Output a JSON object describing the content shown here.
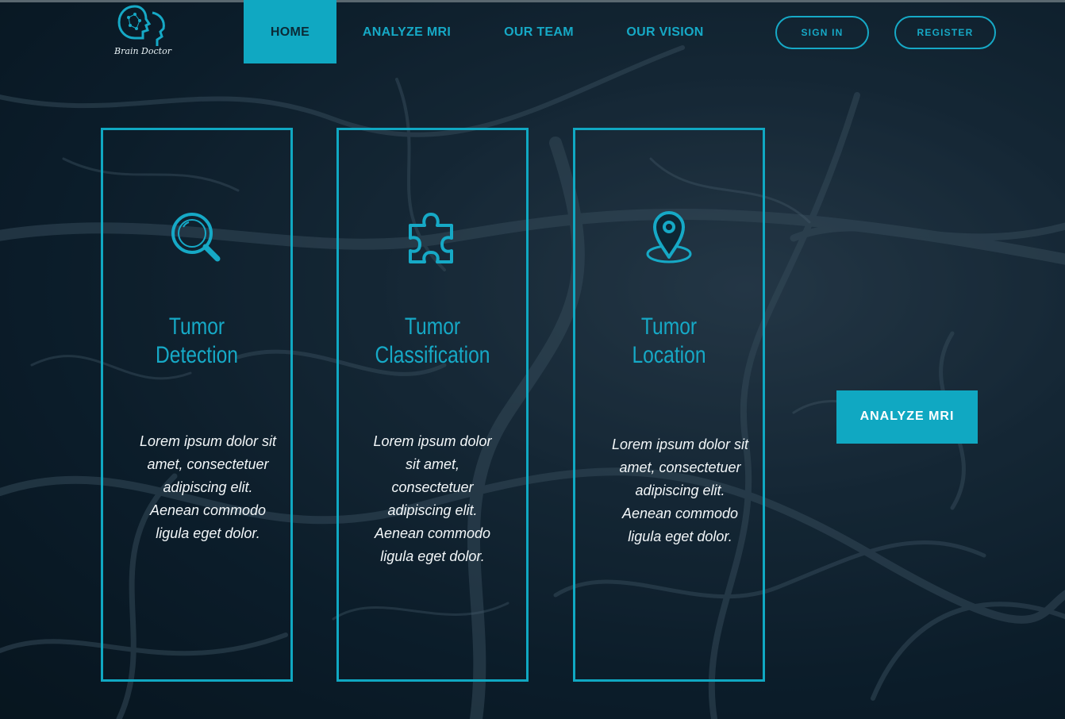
{
  "brand": {
    "name": "Brain Doctor",
    "accent": "#10a8c2"
  },
  "nav": {
    "items": [
      {
        "label": "HOME",
        "active": true
      },
      {
        "label": "ANALYZE MRI",
        "active": false
      },
      {
        "label": "OUR TEAM",
        "active": false
      },
      {
        "label": "OUR VISION",
        "active": false
      }
    ]
  },
  "auth": {
    "sign_in": "SIGN IN",
    "register": "REGISTER"
  },
  "cards": [
    {
      "icon": "magnifier-icon",
      "title_line1": "Tumor",
      "title_line2": "Detection",
      "text": "Lorem ipsum dolor sit amet, consectetuer adipiscing elit. Aenean commodo ligula eget dolor."
    },
    {
      "icon": "puzzle-icon",
      "title_line1": "Tumor",
      "title_line2": "Classification",
      "text": "Lorem ipsum dolor sit amet, consectetuer adipiscing elit. Aenean commodo ligula eget dolor."
    },
    {
      "icon": "location-pin-icon",
      "title_line1": "Tumor",
      "title_line2": "Location",
      "text": "Lorem ipsum dolor sit amet, consectetuer adipiscing elit. Aenean commodo ligula eget dolor."
    }
  ],
  "cta": {
    "label": "ANALYZE MRI"
  }
}
